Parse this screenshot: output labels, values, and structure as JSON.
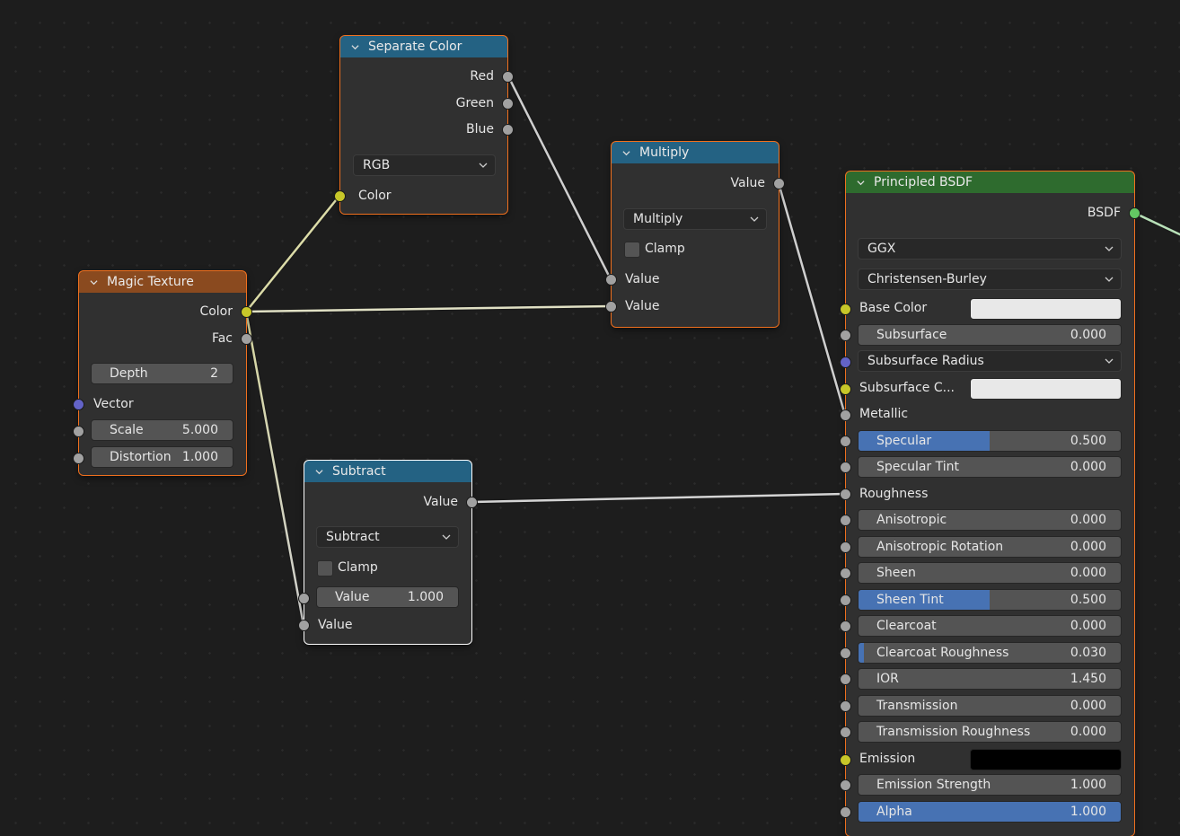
{
  "editor": "Shader Node Editor",
  "colors": {
    "background": "#1d1d1d",
    "node_body": "#303030",
    "header_texture": "#8a4a1f",
    "header_converter": "#246283",
    "header_shader": "#2e6b2e",
    "selected_outline": "#f0701e",
    "active_outline": "#ffffff",
    "slider_fill": "#4772b3",
    "socket_color": "#c7c729",
    "socket_float": "#a1a1a1",
    "socket_vector": "#6363c7",
    "socket_shader": "#63c763"
  },
  "nodes": {
    "separate_color": {
      "title": "Separate Color",
      "outputs": [
        "Red",
        "Green",
        "Blue"
      ],
      "mode": "RGB",
      "inputs": [
        "Color"
      ]
    },
    "magic_texture": {
      "title": "Magic Texture",
      "outputs": [
        "Color",
        "Fac"
      ],
      "depth": {
        "label": "Depth",
        "value": "2"
      },
      "inputs": {
        "vector": "Vector",
        "scale": {
          "label": "Scale",
          "value": "5.000"
        },
        "distortion": {
          "label": "Distortion",
          "value": "1.000"
        }
      }
    },
    "multiply": {
      "title": "Multiply",
      "output": "Value",
      "operation": "Multiply",
      "clamp_label": "Clamp",
      "clamp_checked": false,
      "inputs": [
        "Value",
        "Value"
      ]
    },
    "subtract": {
      "title": "Subtract",
      "output": "Value",
      "operation": "Subtract",
      "clamp_label": "Clamp",
      "clamp_checked": false,
      "value_field": {
        "label": "Value",
        "value": "1.000"
      },
      "input_label": "Value"
    },
    "principled_bsdf": {
      "title": "Principled BSDF",
      "output": "BSDF",
      "distribution": "GGX",
      "subsurface_method": "Christensen-Burley",
      "base_color": {
        "label": "Base Color",
        "color": "#e8e8e8"
      },
      "subsurface": {
        "label": "Subsurface",
        "value": "0.000",
        "fraction": 0
      },
      "subsurface_radius": "Subsurface Radius",
      "subsurface_color": {
        "label": "Subsurface C...",
        "color": "#e8e8e8"
      },
      "metallic": "Metallic",
      "specular": {
        "label": "Specular",
        "value": "0.500",
        "fraction": 0.5
      },
      "specular_tint": {
        "label": "Specular Tint",
        "value": "0.000",
        "fraction": 0
      },
      "roughness": "Roughness",
      "anisotropic": {
        "label": "Anisotropic",
        "value": "0.000",
        "fraction": 0
      },
      "anisotropic_rotation": {
        "label": "Anisotropic Rotation",
        "value": "0.000",
        "fraction": 0
      },
      "sheen": {
        "label": "Sheen",
        "value": "0.000",
        "fraction": 0
      },
      "sheen_tint": {
        "label": "Sheen Tint",
        "value": "0.500",
        "fraction": 0.5
      },
      "clearcoat": {
        "label": "Clearcoat",
        "value": "0.000",
        "fraction": 0
      },
      "clearcoat_roughness": {
        "label": "Clearcoat Roughness",
        "value": "0.030",
        "fraction": 0.03
      },
      "ior": {
        "label": "IOR",
        "value": "1.450",
        "fraction": 0
      },
      "transmission": {
        "label": "Transmission",
        "value": "0.000",
        "fraction": 0
      },
      "transmission_roughness": {
        "label": "Transmission Roughness",
        "value": "0.000",
        "fraction": 0
      },
      "emission": {
        "label": "Emission",
        "color": "#000000"
      },
      "emission_strength": {
        "label": "Emission Strength",
        "value": "1.000",
        "fraction": 0
      },
      "alpha": {
        "label": "Alpha",
        "value": "1.000",
        "fraction": 1
      }
    }
  },
  "links": [
    {
      "from": "magic_texture.Color",
      "to": "separate_color.Color"
    },
    {
      "from": "magic_texture.Color",
      "to": "multiply.Value[1]"
    },
    {
      "from": "magic_texture.Color",
      "to": "subtract.Value[1]"
    },
    {
      "from": "separate_color.Red",
      "to": "multiply.Value[0]"
    },
    {
      "from": "multiply.Value",
      "to": "principled_bsdf.Metallic"
    },
    {
      "from": "subtract.Value",
      "to": "principled_bsdf.Roughness"
    },
    {
      "from": "principled_bsdf.BSDF",
      "to": "material_output.Surface"
    }
  ]
}
